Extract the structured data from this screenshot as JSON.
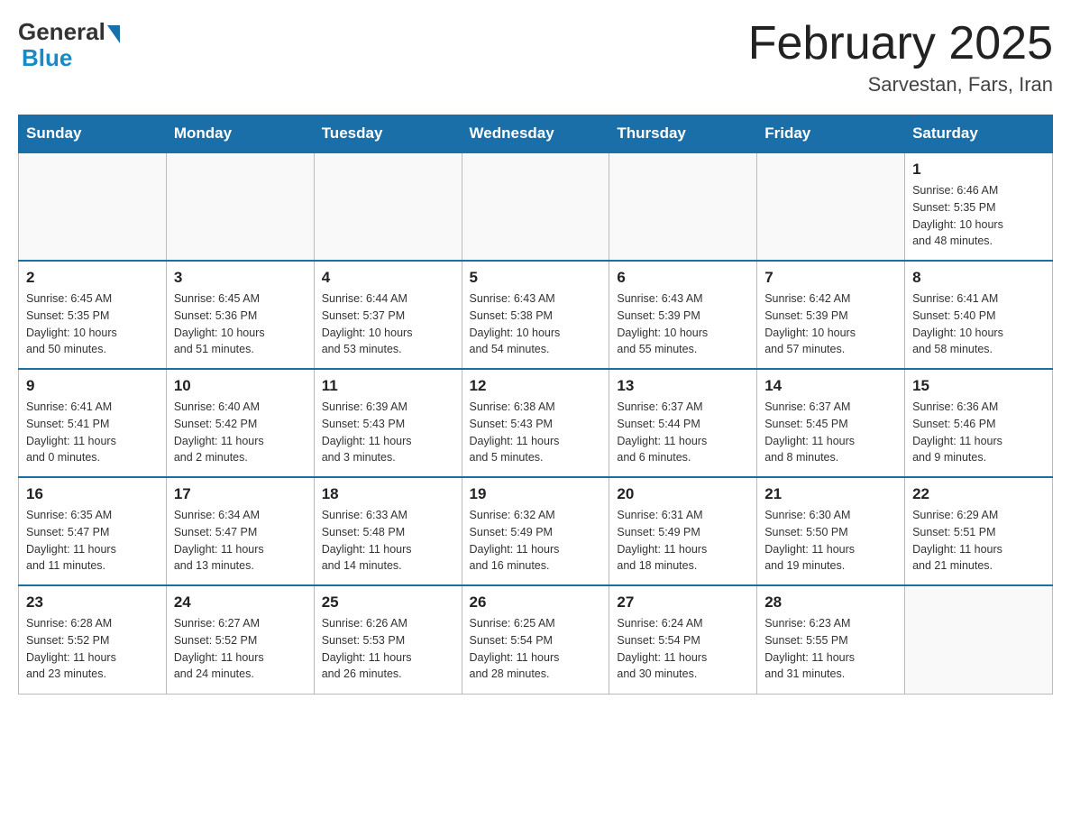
{
  "header": {
    "logo_general": "General",
    "logo_blue": "Blue",
    "month_title": "February 2025",
    "location": "Sarvestan, Fars, Iran"
  },
  "weekdays": [
    "Sunday",
    "Monday",
    "Tuesday",
    "Wednesday",
    "Thursday",
    "Friday",
    "Saturday"
  ],
  "weeks": [
    {
      "days": [
        {
          "num": "",
          "info": ""
        },
        {
          "num": "",
          "info": ""
        },
        {
          "num": "",
          "info": ""
        },
        {
          "num": "",
          "info": ""
        },
        {
          "num": "",
          "info": ""
        },
        {
          "num": "",
          "info": ""
        },
        {
          "num": "1",
          "info": "Sunrise: 6:46 AM\nSunset: 5:35 PM\nDaylight: 10 hours\nand 48 minutes."
        }
      ]
    },
    {
      "days": [
        {
          "num": "2",
          "info": "Sunrise: 6:45 AM\nSunset: 5:35 PM\nDaylight: 10 hours\nand 50 minutes."
        },
        {
          "num": "3",
          "info": "Sunrise: 6:45 AM\nSunset: 5:36 PM\nDaylight: 10 hours\nand 51 minutes."
        },
        {
          "num": "4",
          "info": "Sunrise: 6:44 AM\nSunset: 5:37 PM\nDaylight: 10 hours\nand 53 minutes."
        },
        {
          "num": "5",
          "info": "Sunrise: 6:43 AM\nSunset: 5:38 PM\nDaylight: 10 hours\nand 54 minutes."
        },
        {
          "num": "6",
          "info": "Sunrise: 6:43 AM\nSunset: 5:39 PM\nDaylight: 10 hours\nand 55 minutes."
        },
        {
          "num": "7",
          "info": "Sunrise: 6:42 AM\nSunset: 5:39 PM\nDaylight: 10 hours\nand 57 minutes."
        },
        {
          "num": "8",
          "info": "Sunrise: 6:41 AM\nSunset: 5:40 PM\nDaylight: 10 hours\nand 58 minutes."
        }
      ]
    },
    {
      "days": [
        {
          "num": "9",
          "info": "Sunrise: 6:41 AM\nSunset: 5:41 PM\nDaylight: 11 hours\nand 0 minutes."
        },
        {
          "num": "10",
          "info": "Sunrise: 6:40 AM\nSunset: 5:42 PM\nDaylight: 11 hours\nand 2 minutes."
        },
        {
          "num": "11",
          "info": "Sunrise: 6:39 AM\nSunset: 5:43 PM\nDaylight: 11 hours\nand 3 minutes."
        },
        {
          "num": "12",
          "info": "Sunrise: 6:38 AM\nSunset: 5:43 PM\nDaylight: 11 hours\nand 5 minutes."
        },
        {
          "num": "13",
          "info": "Sunrise: 6:37 AM\nSunset: 5:44 PM\nDaylight: 11 hours\nand 6 minutes."
        },
        {
          "num": "14",
          "info": "Sunrise: 6:37 AM\nSunset: 5:45 PM\nDaylight: 11 hours\nand 8 minutes."
        },
        {
          "num": "15",
          "info": "Sunrise: 6:36 AM\nSunset: 5:46 PM\nDaylight: 11 hours\nand 9 minutes."
        }
      ]
    },
    {
      "days": [
        {
          "num": "16",
          "info": "Sunrise: 6:35 AM\nSunset: 5:47 PM\nDaylight: 11 hours\nand 11 minutes."
        },
        {
          "num": "17",
          "info": "Sunrise: 6:34 AM\nSunset: 5:47 PM\nDaylight: 11 hours\nand 13 minutes."
        },
        {
          "num": "18",
          "info": "Sunrise: 6:33 AM\nSunset: 5:48 PM\nDaylight: 11 hours\nand 14 minutes."
        },
        {
          "num": "19",
          "info": "Sunrise: 6:32 AM\nSunset: 5:49 PM\nDaylight: 11 hours\nand 16 minutes."
        },
        {
          "num": "20",
          "info": "Sunrise: 6:31 AM\nSunset: 5:49 PM\nDaylight: 11 hours\nand 18 minutes."
        },
        {
          "num": "21",
          "info": "Sunrise: 6:30 AM\nSunset: 5:50 PM\nDaylight: 11 hours\nand 19 minutes."
        },
        {
          "num": "22",
          "info": "Sunrise: 6:29 AM\nSunset: 5:51 PM\nDaylight: 11 hours\nand 21 minutes."
        }
      ]
    },
    {
      "days": [
        {
          "num": "23",
          "info": "Sunrise: 6:28 AM\nSunset: 5:52 PM\nDaylight: 11 hours\nand 23 minutes."
        },
        {
          "num": "24",
          "info": "Sunrise: 6:27 AM\nSunset: 5:52 PM\nDaylight: 11 hours\nand 24 minutes."
        },
        {
          "num": "25",
          "info": "Sunrise: 6:26 AM\nSunset: 5:53 PM\nDaylight: 11 hours\nand 26 minutes."
        },
        {
          "num": "26",
          "info": "Sunrise: 6:25 AM\nSunset: 5:54 PM\nDaylight: 11 hours\nand 28 minutes."
        },
        {
          "num": "27",
          "info": "Sunrise: 6:24 AM\nSunset: 5:54 PM\nDaylight: 11 hours\nand 30 minutes."
        },
        {
          "num": "28",
          "info": "Sunrise: 6:23 AM\nSunset: 5:55 PM\nDaylight: 11 hours\nand 31 minutes."
        },
        {
          "num": "",
          "info": ""
        }
      ]
    }
  ]
}
